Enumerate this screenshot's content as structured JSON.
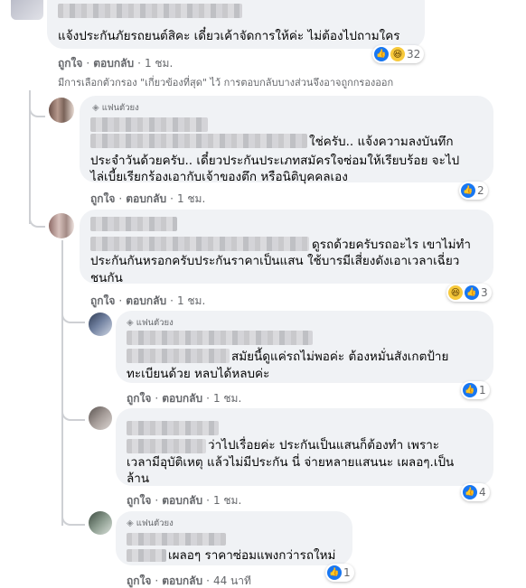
{
  "top_comment": {
    "text": "แจ้งประกันภัยรถยนต์สิคะ เดี๋ยวเค้าจัดการให้ค่ะ ไม่ต้องไปถามใคร",
    "reaction_count": "32"
  },
  "actions": {
    "like": "ถูกใจ",
    "reply": "ตอบกลับ",
    "sep": "·"
  },
  "times": {
    "one_hour": "1 ชม.",
    "forty_four_min": "44 นาที"
  },
  "filter_note": "มีการเลือกตัวกรอง \"เกี่ยวข้องที่สุด\" ไว้ การตอบกลับบางส่วนจึงอาจถูกกรองออก",
  "fan_badge": "แฟนตัวยง",
  "replies": [
    {
      "lines": [
        "ใช่ครับ.. แจ้งความลงบันทึก",
        "ประจำวันด้วยครับ.. เดี๋ยวประกันประเภทสมัครใจซ่อมให้เรียบร้อย จะไป",
        "ไล่เบี้ยเรียกร้องเอากับเจ้าของตึก หรือนิติบุคคลเอง"
      ],
      "reaction_count": "2"
    },
    {
      "lines": [
        "ดูรถด้วยครับรถอะไร เขาไม่ทำ",
        "ประกันกันหรอกครับประกันราคาเป็นแสน ใช้บารมีเสี่ยงดังเอาเวลาเฉี่ยว",
        "ชนกัน"
      ],
      "reaction_count": "3"
    }
  ],
  "nested": [
    {
      "lines": [
        "สมัยนี้ดูแค่รถไม่พอค่ะ ต้องหมั่นสังเกตป้าย",
        "ทะเบียนด้วย หลบได้หลบค่ะ"
      ],
      "reaction_count": "1"
    },
    {
      "lines": [
        "ว่าไปเรื่อยค่ะ ประกันเป็นแสนก็ต้องทำ เพราะ",
        "เวลามีอุบัติเหตุ แล้วไม่มีประกัน นี่ จ่ายหลายแสนนะ เผลอๆ.เป็น",
        "ล้าน"
      ],
      "reaction_count": "4"
    },
    {
      "lines": [
        "เผลอๆ ราคาซ่อมแพงกว่ารถใหม่"
      ],
      "reaction_count": "1"
    }
  ],
  "colors": {
    "bubble": "#f0f2f5",
    "like": "#1877f2",
    "secondary_text": "#65676b",
    "thread_line": "#ced0d4"
  },
  "icons": [
    "like-reaction-icon",
    "haha-reaction-icon",
    "diamond-badge-icon"
  ]
}
